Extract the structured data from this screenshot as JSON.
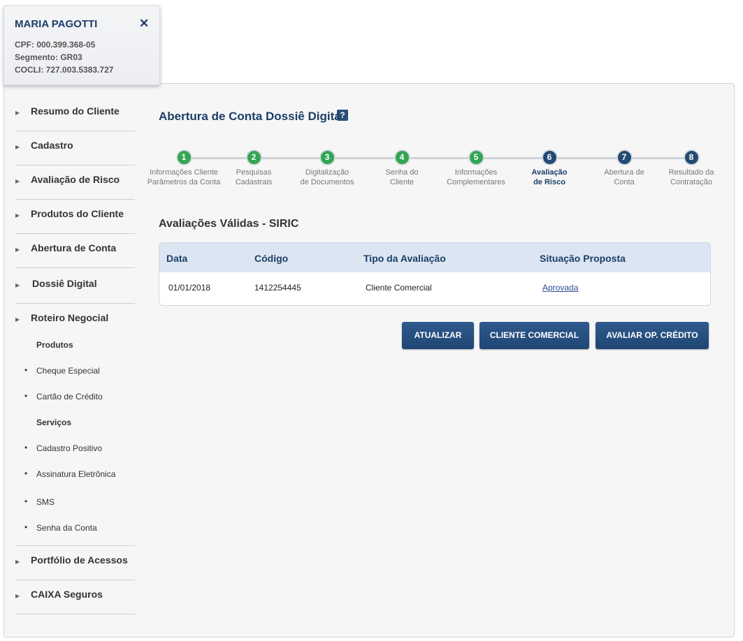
{
  "client": {
    "name": "MARIA PAGOTTI",
    "close_symbol": "✕",
    "cpf": "CPF: 000.399.368-05",
    "segmento": "Segmento: GR03",
    "cocli": "COCLI: 727.003.5383.727"
  },
  "sidebar": {
    "items": [
      {
        "label": "Resumo do Cliente",
        "icon": "caret-right-icon"
      },
      {
        "label": "Cadastro",
        "icon": "caret-right-icon"
      },
      {
        "label": "Avaliação de Risco",
        "icon": "caret-right-icon"
      },
      {
        "label": "Produtos do Cliente",
        "icon": "caret-right-icon"
      },
      {
        "label": "Abertura de Conta",
        "icon": "caret-right-icon"
      },
      {
        "label": "Dossiê Digital",
        "icon": "caret-right-icon"
      },
      {
        "label": "Roteiro Negocial",
        "icon": "caret-right-icon"
      }
    ],
    "roteiro": {
      "produtos_heading": "Produtos",
      "produtos": [
        "Cheque Especial",
        "Cartão de Crédito"
      ],
      "servicos_heading": "Serviços",
      "servicos": [
        "Cadastro Positivo",
        "Assinatura Eletrônica",
        "SMS",
        "Senha da Conta"
      ]
    },
    "bottom_items": [
      {
        "label": "Portfólio de Acessos",
        "icon": "caret-right-icon"
      },
      {
        "label": "CAIXA Seguros",
        "icon": "caret-right-icon"
      }
    ],
    "arrow_symbol": "▶",
    "bullet_symbol": "•"
  },
  "page": {
    "title": "Abertura de Conta Dossiê Digital",
    "help_symbol": "?"
  },
  "stepper": {
    "current_step": 6,
    "steps": [
      {
        "number": "1",
        "line1": "Informações Cliente",
        "line2": "Parâmetros da Conta",
        "status": "done"
      },
      {
        "number": "2",
        "line1": "Pesquisas",
        "line2": "Cadastrais",
        "status": "done"
      },
      {
        "number": "3",
        "line1": "Digitalização",
        "line2": "de Documentos",
        "status": "done"
      },
      {
        "number": "4",
        "line1": "Senha do",
        "line2": "Cliente",
        "status": "done"
      },
      {
        "number": "5",
        "line1": "Informações",
        "line2": "Complementares",
        "status": "done"
      },
      {
        "number": "6",
        "line1": "Avaliação",
        "line2": "de Risco",
        "status": "current"
      },
      {
        "number": "7",
        "line1": "Abertura de",
        "line2": "Conta",
        "status": "todo"
      },
      {
        "number": "8",
        "line1": "Resultado da",
        "line2": "Contratação",
        "status": "todo"
      }
    ],
    "colors": {
      "done": "#33a553",
      "todo": "#234a73"
    }
  },
  "avaliacoes": {
    "title": "Avaliações Válidas - SIRIC",
    "columns": [
      "Data",
      "Código",
      "Tipo da Avaliação",
      "Situação Proposta"
    ],
    "rows": [
      {
        "data": "01/01/2018",
        "codigo": "1412254445",
        "tipo": "Cliente Comercial",
        "situacao": "Aprovada"
      }
    ]
  },
  "actions": {
    "atualizar": "ATUALIZAR",
    "cliente_comercial": "CLIENTE COMERCIAL",
    "avaliar": "AVALIAR OP. CRÉDITO"
  },
  "colors": {
    "brand": "#1c3e66",
    "button": "#24507f",
    "table_header_bg": "#dce6f3"
  }
}
